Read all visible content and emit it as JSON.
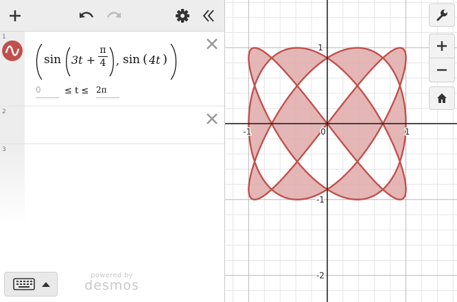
{
  "rows": [
    {
      "number": "1",
      "expression": {
        "fn1": "sin",
        "arg_a": "3t +",
        "frac_num": "π",
        "frac_den": "4",
        "comma": ",",
        "fn2": "sin",
        "arg_b": "4t"
      },
      "range": {
        "min_placeholder": "0",
        "operator_text": "≤ t ≤",
        "max_value": "2π"
      },
      "color": "#c0504d"
    },
    {
      "number": "2"
    },
    {
      "number": "3"
    }
  ],
  "branding": {
    "powered_by": "powered by",
    "name": "desmos"
  },
  "graph": {
    "x_range": [
      -1.3,
      1.65
    ],
    "y_range": [
      -2.35,
      1.63
    ],
    "minor_grid": 0.2,
    "major_grid": 1,
    "tick_labels": {
      "x": [
        "-1",
        "0",
        "1"
      ],
      "y": [
        "1",
        "-1",
        "-2"
      ]
    },
    "curve_color": "#c0504d",
    "fill_color": "#dfa9a8"
  },
  "icons": {
    "add": "plus-icon",
    "undo": "undo-icon",
    "redo": "redo-icon",
    "settings": "gear-icon",
    "collapse": "double-chevron-left-icon",
    "wrench": "wrench-icon",
    "zoom_in": "plus-icon",
    "zoom_out": "minus-icon",
    "home": "home-icon",
    "keyboard": "keyboard-icon"
  }
}
